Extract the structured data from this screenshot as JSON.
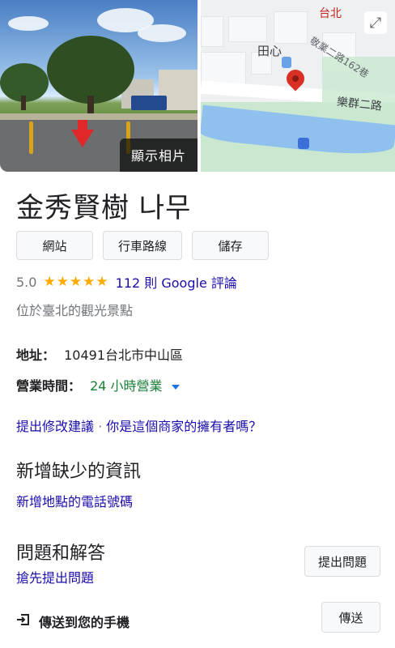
{
  "photo": {
    "label": "顯示相片"
  },
  "map": {
    "labels": {
      "district": "田心",
      "city": "台北",
      "road1": "敬業二路162巷",
      "road2": "樂群二路"
    },
    "expand_icon": "expand-icon",
    "pin_color": "#d93025"
  },
  "place": {
    "title": "金秀賢樹 나무",
    "buttons": {
      "website": "網站",
      "directions": "行車路線",
      "save": "儲存"
    },
    "rating": {
      "value": "5.0",
      "stars": 5,
      "reviews": "112 則 Google 評論"
    },
    "category": "位於臺北的觀光景點",
    "address": {
      "label": "地址：",
      "value": "10491台北市中山區"
    },
    "hours": {
      "label": "營業時間：",
      "value": "24 小時營業"
    },
    "suggest": {
      "edit": "提出修改建議",
      "sep": " · ",
      "owner": "你是這個商家的擁有者嗎？"
    }
  },
  "missing_info": {
    "title": "新增缺少的資訊",
    "link": "新增地點的電話號碼"
  },
  "qa": {
    "title": "問題和解答",
    "link": "搶先提出問題",
    "button": "提出問題"
  },
  "send": {
    "label": "傳送到您的手機",
    "button": "傳送"
  },
  "colors": {
    "star": "#f9ab00",
    "link": "#1a0dab",
    "open": "#188038"
  }
}
